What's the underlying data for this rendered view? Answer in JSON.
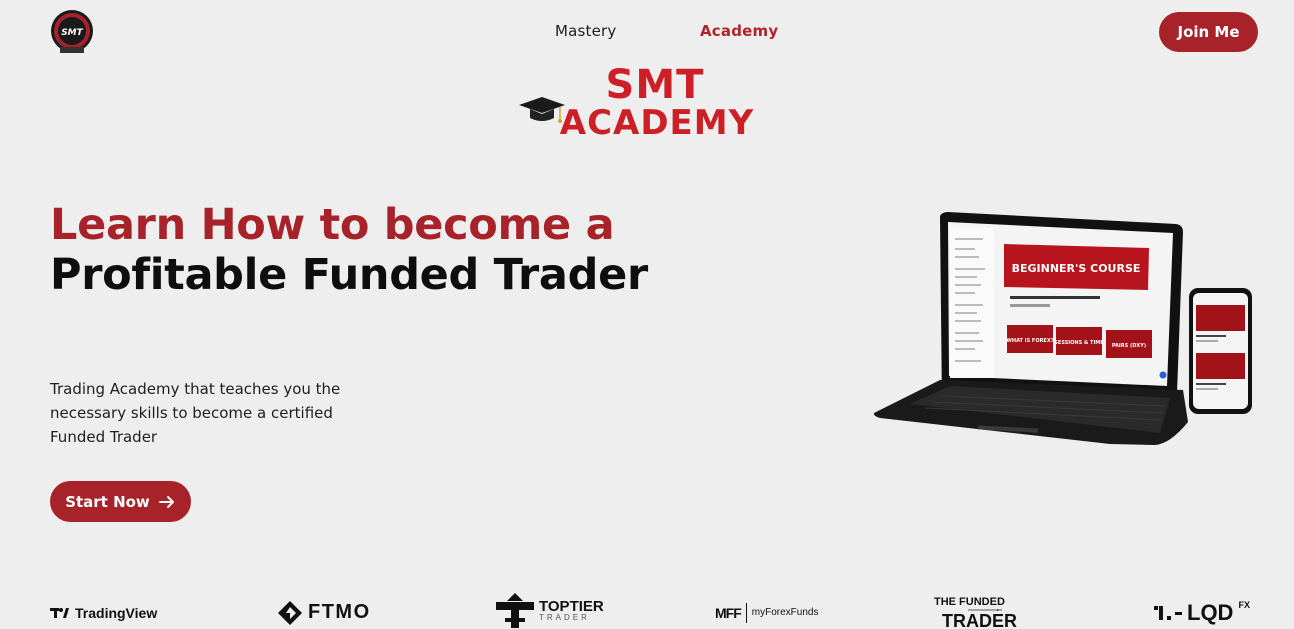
{
  "header": {
    "logo_icon": "smt-logo-icon",
    "nav": [
      {
        "label": "Mastery"
      },
      {
        "label": "Academy"
      }
    ],
    "join_label": "Join Me"
  },
  "brand": {
    "line1": "SMT",
    "line2": "ACADEMY",
    "icon": "graduation-cap-icon"
  },
  "hero": {
    "title_line1": "Learn How to become a",
    "title_line2": "Profitable Funded Trader",
    "description": "Trading Academy that teaches you the necessary skills to become a certified Funded Trader",
    "cta_label": "Start Now",
    "cta_icon": "arrow-right-icon"
  },
  "devices": {
    "screen_banner": "BEGINNER'S COURSE",
    "thumbs": [
      "WHAT IS FOREX?",
      "SESSIONS & TIME",
      "PAIRS (DXY)"
    ]
  },
  "partners": [
    {
      "name": "TradingView"
    },
    {
      "name": "FTMO"
    },
    {
      "name": "TOPTIER",
      "sub": "TRADER"
    },
    {
      "name": "myForexFunds",
      "mark": "MFF"
    },
    {
      "name": "THE FUNDED",
      "sub": "TRADER"
    },
    {
      "name": "LQD",
      "sup": "FX"
    }
  ],
  "colors": {
    "accent": "#a8222a",
    "background": "#efeeee",
    "text": "#0e0e0e"
  }
}
